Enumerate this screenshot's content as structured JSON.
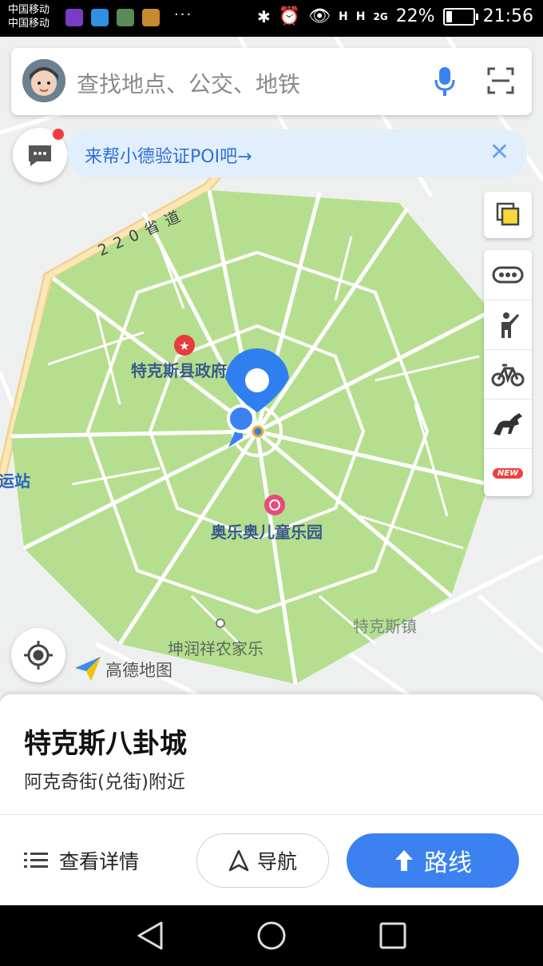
{
  "status_bar": {
    "carrier_1": "中国移动",
    "carrier_2": "中国移动",
    "more": "···",
    "signal_h1": "H",
    "signal_h2": "H",
    "signal_2g": "2G",
    "battery": "22%",
    "battery_level": 0.22,
    "time": "21:56"
  },
  "search": {
    "placeholder": "查找地点、公交、地铁"
  },
  "banner": {
    "text": "来帮小德验证POI吧→",
    "close": "✕"
  },
  "map": {
    "road_label": "220省道",
    "poi_county_gov": "特克斯县政府",
    "poi_bus_station": "客运站",
    "poi_amusement": "奥乐奥儿童乐园",
    "poi_town": "特克斯镇",
    "poi_farm": "坤润祥农家乐",
    "logo": "高德地图"
  },
  "place": {
    "name": "特克斯八卦城",
    "address": "阿克奇街(兑街)附近"
  },
  "actions": {
    "details": "查看详情",
    "navigate": "导航",
    "route": "路线"
  },
  "colors": {
    "accent": "#3b82f0",
    "park_green": "#b5df8e",
    "marker_blue": "#2f7ff0"
  }
}
